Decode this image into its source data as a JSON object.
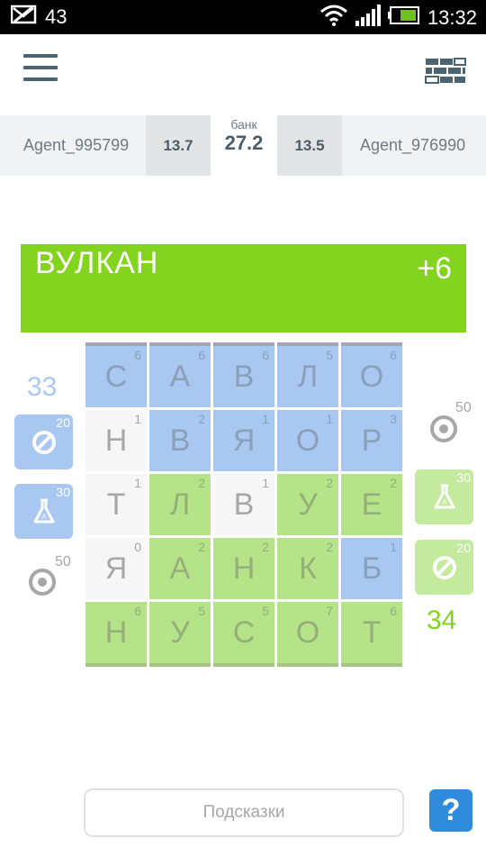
{
  "status_bar": {
    "notification_count": "43",
    "time": "13:32",
    "icons": [
      "mail-icon",
      "wifi-icon",
      "signal-icon",
      "battery-icon"
    ]
  },
  "header": {
    "menu_icon": "hamburger-menu-icon",
    "wall_icon": "brick-wall-icon"
  },
  "scoreboard": {
    "player1": {
      "name": "Agent_995799",
      "score": "13.7"
    },
    "bank": {
      "label": "банк",
      "value": "27.2"
    },
    "player2": {
      "score": "13.5",
      "name": "Agent_976990"
    }
  },
  "word": {
    "text": "ВУЛКАН",
    "score": "+6",
    "color": "#83d41f"
  },
  "grid": {
    "rows": [
      [
        {
          "letter": "С",
          "value": "6",
          "state": "blue"
        },
        {
          "letter": "А",
          "value": "6",
          "state": "blue"
        },
        {
          "letter": "В",
          "value": "6",
          "state": "blue"
        },
        {
          "letter": "Л",
          "value": "5",
          "state": "blue"
        },
        {
          "letter": "О",
          "value": "6",
          "state": "blue"
        }
      ],
      [
        {
          "letter": "Н",
          "value": "1",
          "state": "white"
        },
        {
          "letter": "В",
          "value": "2",
          "state": "blue"
        },
        {
          "letter": "Я",
          "value": "1",
          "state": "blue"
        },
        {
          "letter": "О",
          "value": "1",
          "state": "blue"
        },
        {
          "letter": "Р",
          "value": "3",
          "state": "blue"
        }
      ],
      [
        {
          "letter": "Т",
          "value": "1",
          "state": "white"
        },
        {
          "letter": "Л",
          "value": "2",
          "state": "green"
        },
        {
          "letter": "В",
          "value": "1",
          "state": "white"
        },
        {
          "letter": "У",
          "value": "2",
          "state": "green"
        },
        {
          "letter": "Е",
          "value": "2",
          "state": "green"
        }
      ],
      [
        {
          "letter": "Я",
          "value": "0",
          "state": "white"
        },
        {
          "letter": "А",
          "value": "2",
          "state": "green"
        },
        {
          "letter": "Н",
          "value": "2",
          "state": "green"
        },
        {
          "letter": "К",
          "value": "2",
          "state": "green"
        },
        {
          "letter": "Б",
          "value": "1",
          "state": "blue"
        }
      ],
      [
        {
          "letter": "Н",
          "value": "6",
          "state": "green"
        },
        {
          "letter": "У",
          "value": "5",
          "state": "green"
        },
        {
          "letter": "С",
          "value": "5",
          "state": "green"
        },
        {
          "letter": "О",
          "value": "7",
          "state": "green"
        },
        {
          "letter": "Т",
          "value": "6",
          "state": "green"
        }
      ]
    ],
    "colors": {
      "blue": "#a9c8f1",
      "green": "#b5e388",
      "white": "#f6f6f6"
    }
  },
  "left_panel": {
    "score": "33",
    "powerups": [
      {
        "icon": "block-icon",
        "cost": "20"
      },
      {
        "icon": "flask-icon",
        "cost": "30"
      },
      {
        "icon": "target-icon",
        "cost": "50"
      }
    ]
  },
  "right_panel": {
    "score": "34",
    "powerups": [
      {
        "icon": "target-icon",
        "cost": "50"
      },
      {
        "icon": "flask-icon",
        "cost": "30"
      },
      {
        "icon": "block-icon",
        "cost": "20"
      }
    ]
  },
  "footer": {
    "hint_label": "Подсказки",
    "help_label": "?",
    "help_color": "#2f8bdc"
  }
}
